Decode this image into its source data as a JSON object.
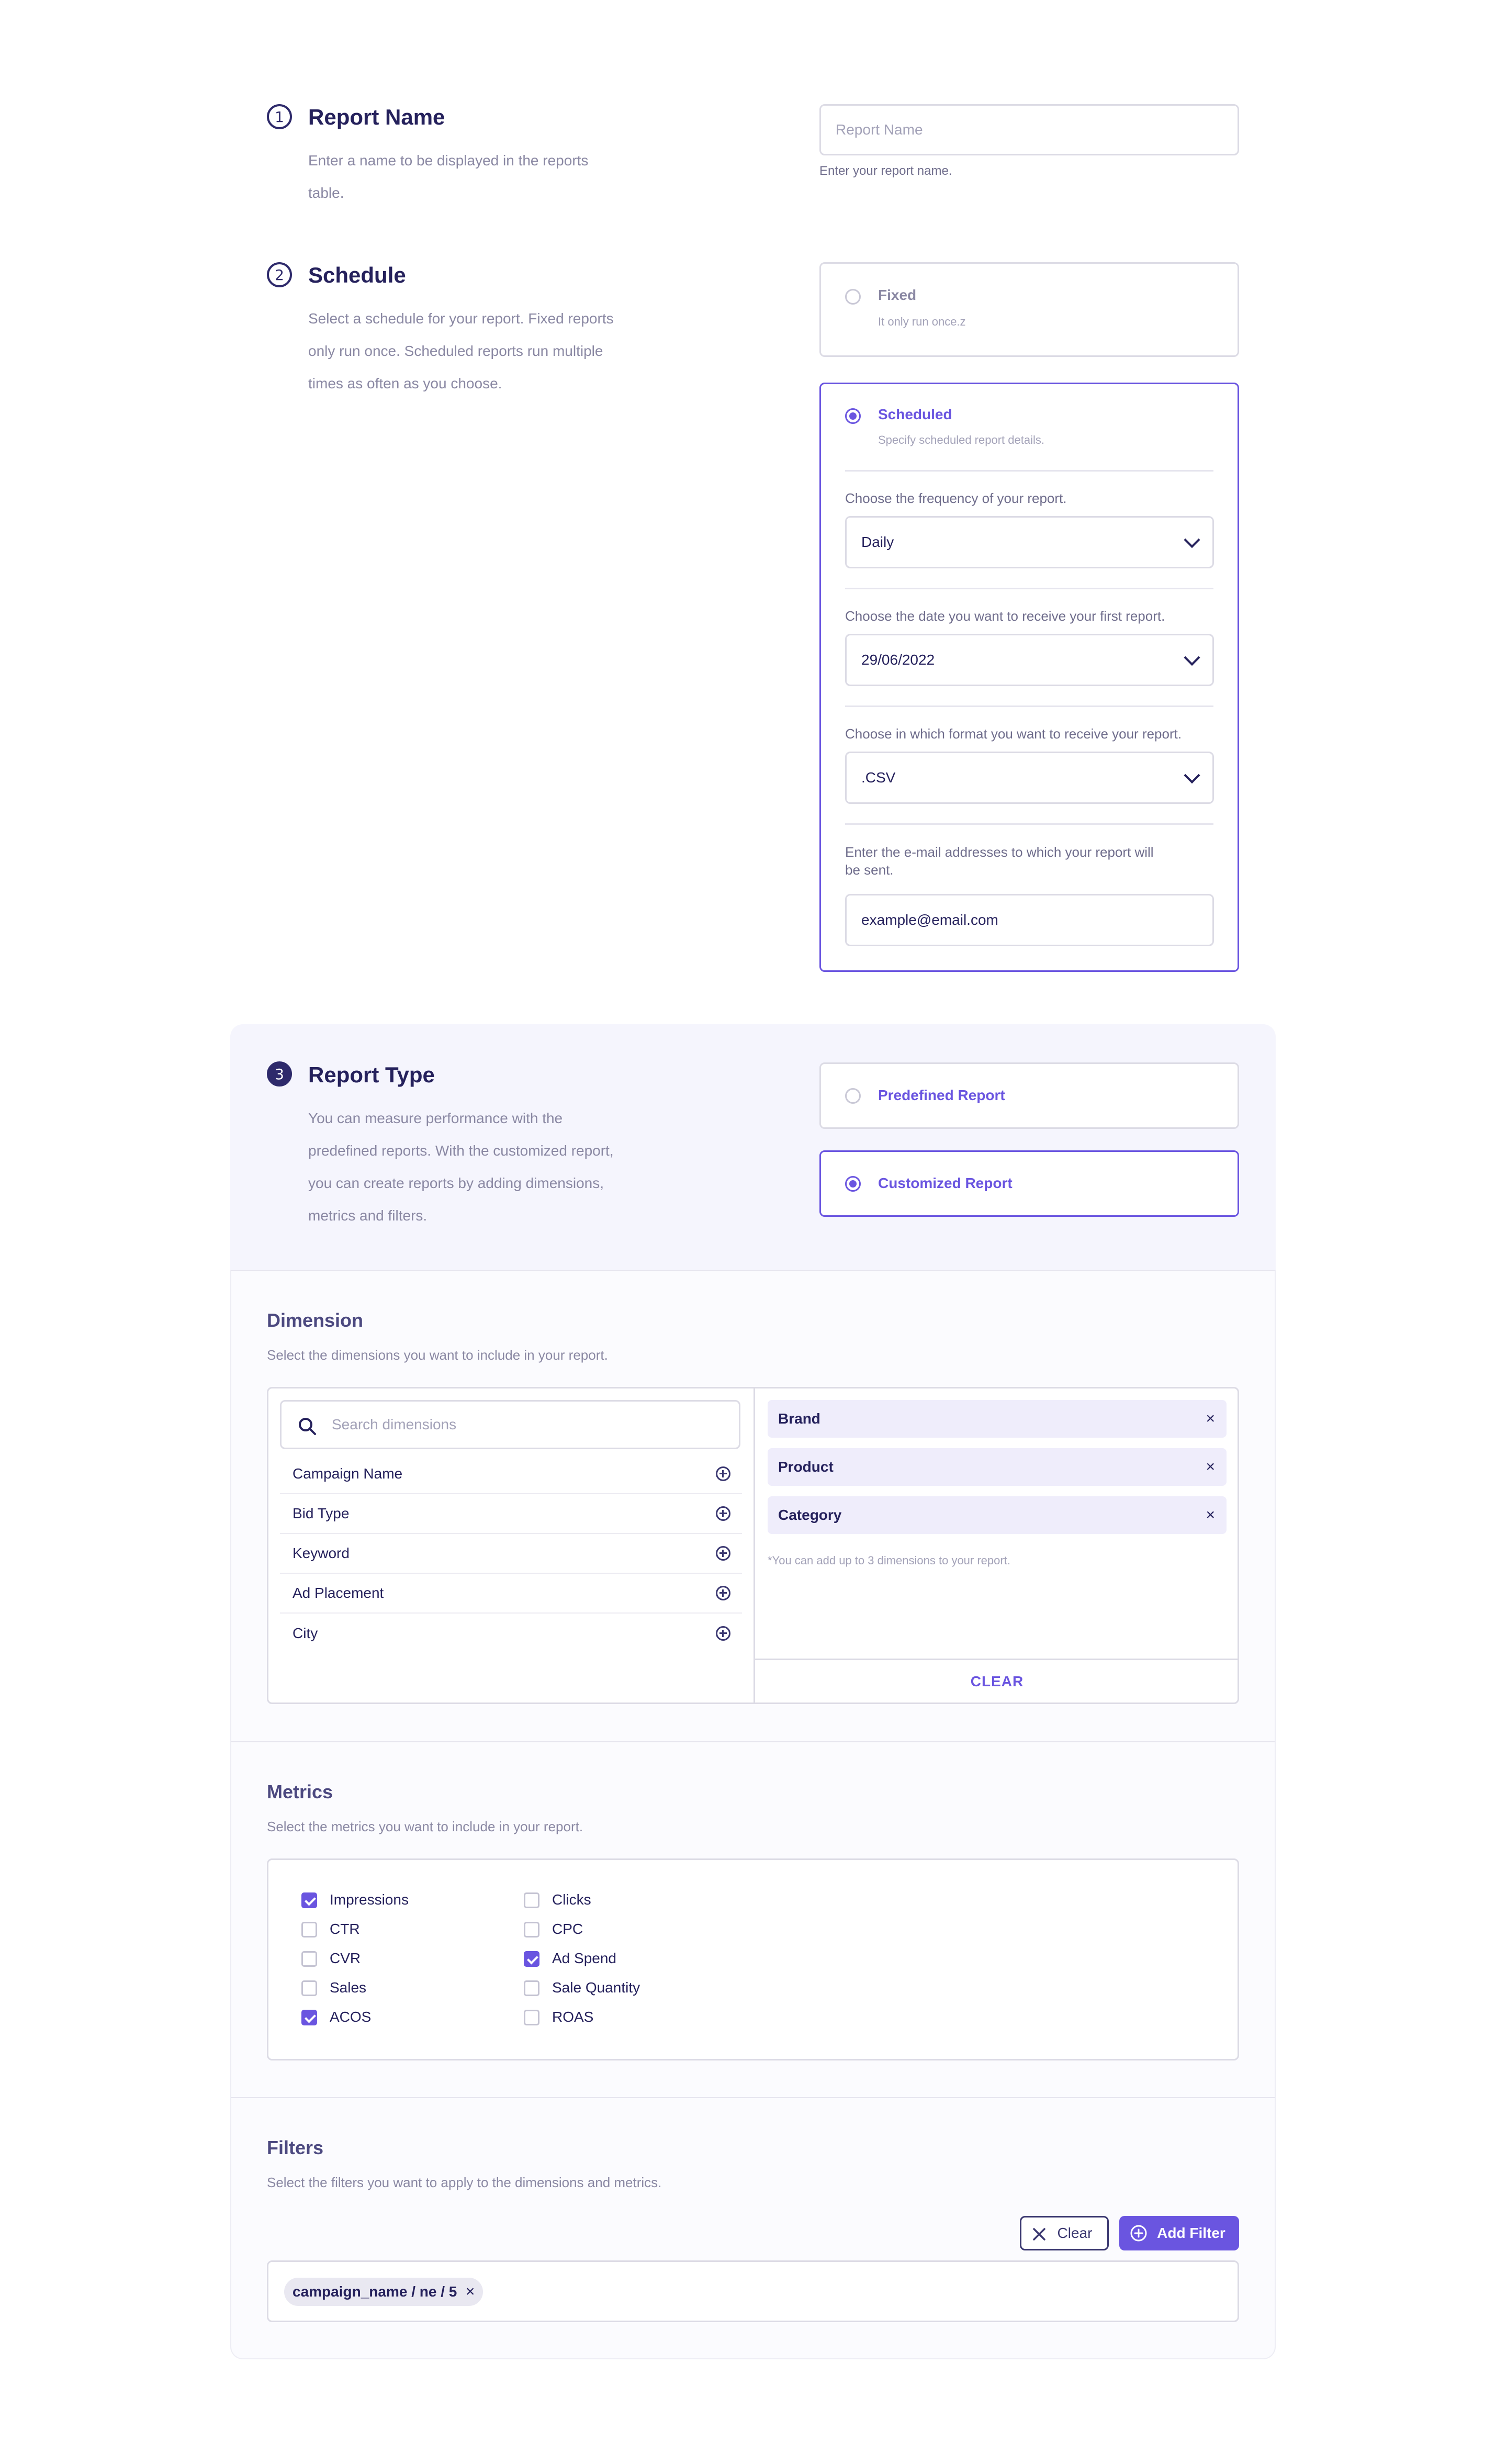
{
  "step1": {
    "number": "1",
    "title": "Report Name",
    "description_line1": "Enter a name to be displayed in the reports",
    "description_line2": "table.",
    "input_placeholder": "Report Name",
    "input_hint": "Enter your report name."
  },
  "step2": {
    "number": "2",
    "title": "Schedule",
    "description_line1": "Select a schedule for your report. Fixed reports",
    "description_line2": "only run once. Scheduled reports run multiple",
    "description_line3": "times as often as you choose.",
    "fixed": {
      "title": "Fixed",
      "subtitle": "It only run once.z",
      "selected": false
    },
    "scheduled": {
      "title": "Scheduled",
      "subtitle": "Specify scheduled report details.",
      "selected": true,
      "frequency_label": "Choose the frequency of your report.",
      "frequency_value": "Daily",
      "date_label": "Choose the date you want to receive your first report.",
      "date_value": "29/06/2022",
      "format_label": "Choose in which format you want to receive your report.",
      "format_value": ".CSV",
      "email_label_line1": "Enter the e-mail addresses to which your report will",
      "email_label_line2": "be sent.",
      "email_value": "example@email.com"
    }
  },
  "step3": {
    "number": "3",
    "title": "Report Type",
    "description_line1": "You can measure performance with the",
    "description_line2": "predefined reports. With the customized report,",
    "description_line3": "you can create reports by adding dimensions,",
    "description_line4": "metrics and filters.",
    "predefined": {
      "label": "Predefined Report",
      "selected": false
    },
    "customized": {
      "label": "Customized Report",
      "selected": true
    }
  },
  "dimension": {
    "title": "Dimension",
    "description": "Select the dimensions you want to include in your report.",
    "search_placeholder": "Search dimensions",
    "available": [
      "Campaign Name",
      "Bid Type",
      "Keyword",
      "Ad Placement",
      "City"
    ],
    "selected": [
      "Brand",
      "Product",
      "Category"
    ],
    "note": "*You can add up to 3 dimensions to your report.",
    "clear_label": "CLEAR"
  },
  "metrics": {
    "title": "Metrics",
    "description": "Select the metrics you want to include in your report.",
    "items": [
      {
        "label": "Impressions",
        "checked": true
      },
      {
        "label": "CTR",
        "checked": false
      },
      {
        "label": "CVR",
        "checked": false
      },
      {
        "label": "Sales",
        "checked": false
      },
      {
        "label": "ACOS",
        "checked": true
      },
      {
        "label": "Clicks",
        "checked": false
      },
      {
        "label": "CPC",
        "checked": false
      },
      {
        "label": "Ad Spend",
        "checked": true
      },
      {
        "label": "Sale Quantity",
        "checked": false
      },
      {
        "label": "ROAS",
        "checked": false
      }
    ]
  },
  "filters": {
    "title": "Filters",
    "description": "Select the filters you want to apply to the dimensions and metrics.",
    "clear_label": "Clear",
    "add_label": "Add Filter",
    "active_filter": "campaign_name / ne / 5",
    "remove_symbol": "×"
  },
  "colors": {
    "accent": "#6a55e0",
    "heading": "#25215c",
    "muted": "#8a88a3",
    "section_bg": "#f5f5fd"
  },
  "icons": [
    "search-icon",
    "plus-circle-icon",
    "close-icon",
    "chevron-down-icon"
  ]
}
